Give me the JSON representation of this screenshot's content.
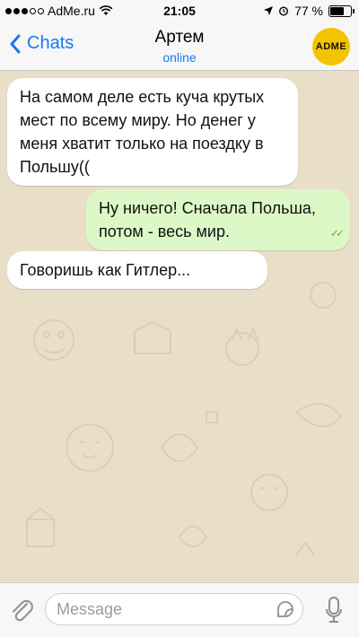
{
  "status": {
    "carrier": "AdMe.ru",
    "time": "21:05",
    "battery": "77 %",
    "battery_level": 0.77
  },
  "header": {
    "back_label": "Chats",
    "contact_name": "Артем",
    "contact_status": "online",
    "avatar_text": "ADME"
  },
  "messages": [
    {
      "direction": "incoming",
      "text": "На самом деле есть куча крутых мест по всему миру. Но денег у меня хватит только на поездку в Польшу(("
    },
    {
      "direction": "outgoing",
      "text": "Ну ничего! Сначала Польша, потом - весь мир.",
      "read_mark": "✓✓"
    },
    {
      "direction": "incoming",
      "text": "Говоришь как Гитлер..."
    }
  ],
  "composer": {
    "placeholder": "Message"
  },
  "colors": {
    "accent": "#1479f5",
    "chat_bg": "#e9dfc9",
    "outgoing_bubble": "#dcf8c6",
    "incoming_bubble": "#ffffff",
    "avatar_bg": "#f4c300"
  }
}
